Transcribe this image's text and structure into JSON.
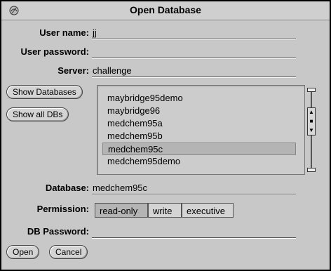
{
  "window": {
    "title": "Open Database"
  },
  "fields": {
    "user_name": {
      "label": "User name:",
      "value": "jj"
    },
    "user_password": {
      "label": "User password:",
      "value": ""
    },
    "server": {
      "label": "Server:",
      "value": "challenge"
    },
    "database": {
      "label": "Database:",
      "value": "medchem95c"
    },
    "permission": {
      "label": "Permission:"
    },
    "db_password": {
      "label": "DB Password:",
      "value": ""
    }
  },
  "buttons": {
    "show_databases": "Show Databases",
    "show_all_dbs": "Show all DBs",
    "open": "Open",
    "cancel": "Cancel"
  },
  "databases": {
    "items": [
      "maybridge95demo",
      "maybridge96",
      "medchem95a",
      "medchem95b",
      "medchem95c",
      "medchem95demo"
    ],
    "selected": "medchem95c"
  },
  "permission_options": [
    {
      "label": "read-only",
      "selected": true
    },
    {
      "label": "write",
      "selected": false
    },
    {
      "label": "executive",
      "selected": false
    }
  ],
  "icons": {
    "window_menu": "window-menu-icon",
    "scroll_up": "arrow-up-icon",
    "scroll_down": "arrow-down-icon"
  }
}
